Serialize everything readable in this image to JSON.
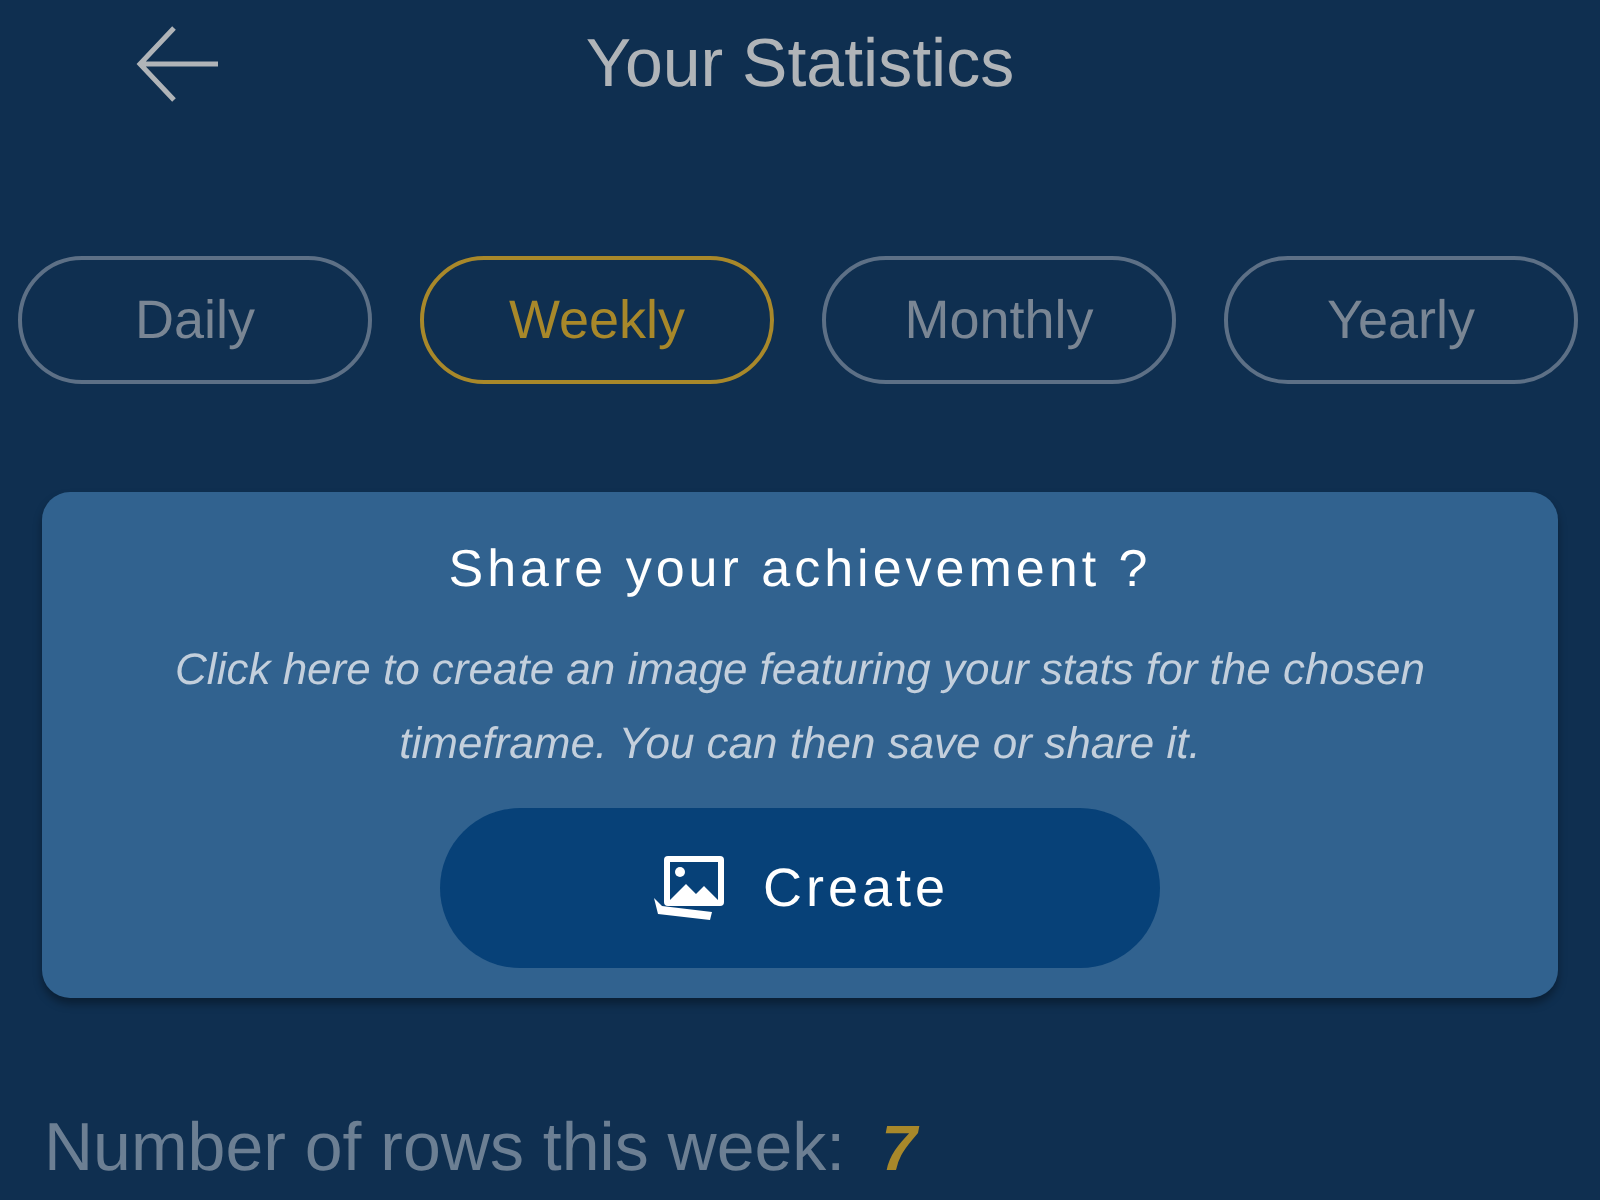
{
  "header": {
    "title": "Your Statistics"
  },
  "tabs": [
    {
      "label": "Daily",
      "selected": false
    },
    {
      "label": "Weekly",
      "selected": true
    },
    {
      "label": "Monthly",
      "selected": false
    },
    {
      "label": "Yearly",
      "selected": false
    }
  ],
  "share_card": {
    "title": "Share your achievement ?",
    "description": "Click here to create an image featuring your stats for the chosen timeframe. You can then save or share it.",
    "button": "Create"
  },
  "stat": {
    "label": "Number of rows this week:",
    "value": "7"
  }
}
